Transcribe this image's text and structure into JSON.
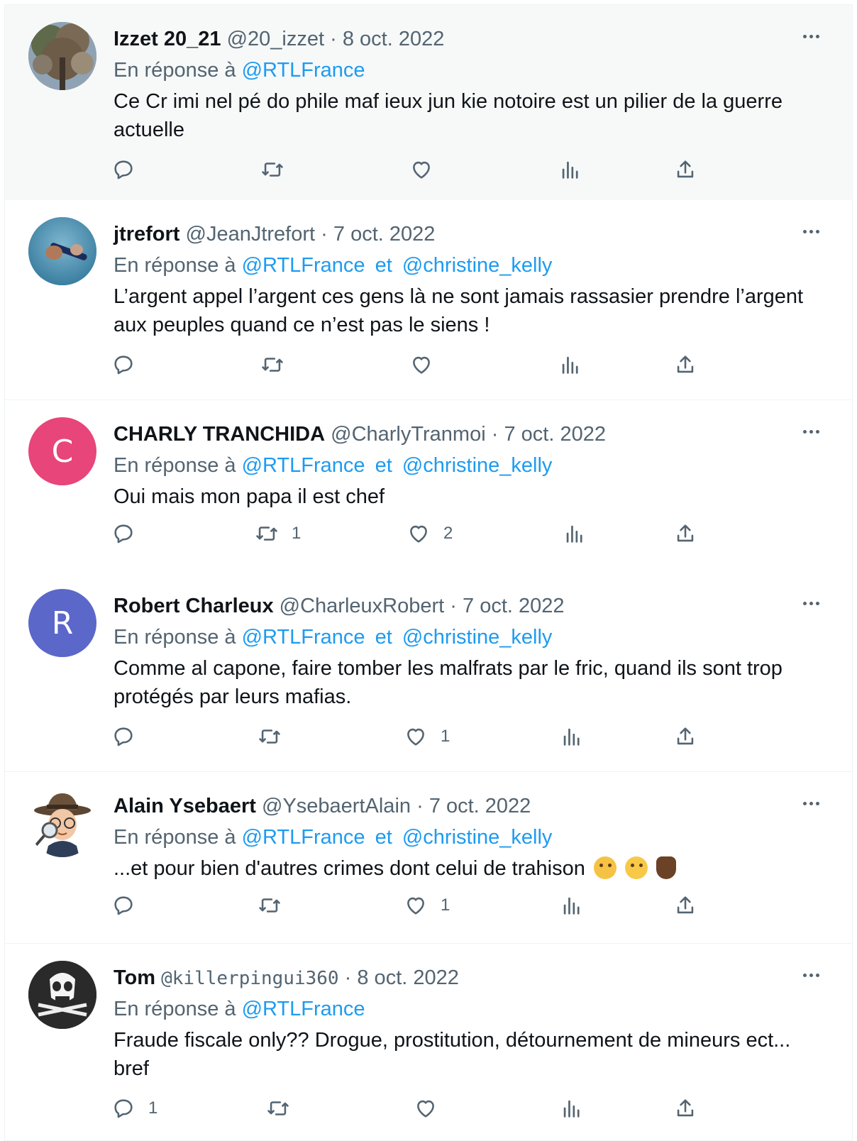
{
  "reply_prefix": "En réponse à",
  "and_word": "et",
  "tweets": [
    {
      "name": "Izzet 20_21",
      "handle": "@20_izzet",
      "sep": "·",
      "date": "8 oct. 2022",
      "mentions": [
        "@RTLFrance"
      ],
      "text": "Ce Cr imi nel pé do phile maf ieux jun kie notoire est un pilier de la guerre actuelle",
      "reply_count": "",
      "retweet_count": "",
      "like_count": "",
      "avatar_icon": "tree-photo-avatar"
    },
    {
      "name": "jtrefort",
      "handle": "@JeanJtrefort",
      "sep": "·",
      "date": "7 oct. 2022",
      "mentions": [
        "@RTLFrance",
        "@christine_kelly"
      ],
      "text": "L’argent appel l’argent ces gens là ne sont jamais rassasier prendre l’argent aux peuples quand ce n’est pas le siens !",
      "reply_count": "",
      "retweet_count": "",
      "like_count": "",
      "avatar_icon": "blue-photo-avatar"
    },
    {
      "name": "CHARLY TRANCHIDA",
      "handle": "@CharlyTranmoi",
      "sep": "·",
      "date": "7 oct. 2022",
      "mentions": [
        "@RTLFrance",
        "@christine_kelly"
      ],
      "text": "Oui mais mon papa il est chef",
      "reply_count": "",
      "retweet_count": "1",
      "like_count": "2",
      "avatar_letter": "C",
      "avatar_color": "#e8457a"
    },
    {
      "name": "Robert Charleux",
      "handle": "@CharleuxRobert",
      "sep": "·",
      "date": "7 oct. 2022",
      "mentions": [
        "@RTLFrance",
        "@christine_kelly"
      ],
      "text": "Comme al capone, faire tomber les malfrats par le fric, quand ils sont trop protégés par leurs mafias.",
      "reply_count": "",
      "retweet_count": "",
      "like_count": "1",
      "avatar_letter": "R",
      "avatar_color": "#5b67c9"
    },
    {
      "name": "Alain Ysebaert",
      "handle": "@YsebaertAlain",
      "sep": "·",
      "date": "7 oct. 2022",
      "mentions": [
        "@RTLFrance",
        "@christine_kelly"
      ],
      "text": "...et pour bien d'autres crimes dont celui de trahison",
      "reply_count": "",
      "retweet_count": "",
      "like_count": "1",
      "avatar_icon": "detective-avatar",
      "emojis": [
        "thinking-face-emoji",
        "winking-face-emoji",
        "thumbs-down-emoji"
      ]
    },
    {
      "name": "Tom",
      "handle": "@killerpingui360",
      "sep": "·",
      "date": "8 oct. 2022",
      "mentions": [
        "@RTLFrance"
      ],
      "text": "Fraude fiscale only?? Drogue, prostitution, détournement de mineurs ect... bref",
      "reply_count": "1",
      "retweet_count": "",
      "like_count": "",
      "avatar_icon": "skull-avatar"
    }
  ],
  "colors": {
    "link": "#1d9bf0",
    "secondary_text": "#536471",
    "primary_text": "#0f1419",
    "divider": "#eff3f4"
  }
}
